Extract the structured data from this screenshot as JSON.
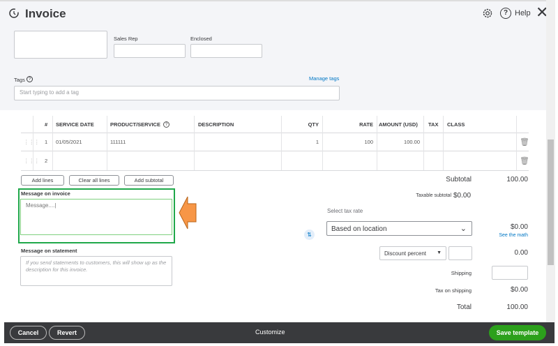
{
  "header": {
    "title": "Invoice",
    "help_label": "Help"
  },
  "form": {
    "sales_rep_label": "Sales Rep",
    "enclosed_label": "Enclosed",
    "tags_label": "Tags",
    "manage_tags": "Manage tags",
    "tags_placeholder": "Start typing to add a tag"
  },
  "table": {
    "columns": [
      "#",
      "SERVICE DATE",
      "PRODUCT/SERVICE",
      "DESCRIPTION",
      "QTY",
      "RATE",
      "AMOUNT (USD)",
      "TAX",
      "CLASS"
    ],
    "rows": [
      {
        "num": "1",
        "date": "01/05/2021",
        "product": "111111",
        "description": "",
        "qty": "1",
        "rate": "100",
        "amount": "100.00"
      },
      {
        "num": "2",
        "date": "",
        "product": "",
        "description": "",
        "qty": "",
        "rate": "",
        "amount": ""
      }
    ]
  },
  "actions": {
    "add_lines": "Add lines",
    "clear_lines": "Clear all lines",
    "add_subtotal": "Add subtotal"
  },
  "messages": {
    "invoice_label": "Message on invoice",
    "invoice_value": "Message....|",
    "statement_label": "Message on statement",
    "statement_placeholder": "If you send statements to customers, this will show up as the description for this invoice."
  },
  "totals": {
    "subtotal_label": "Subtotal",
    "subtotal": "100.00",
    "taxable_label": "Taxable subtotal",
    "taxable": "$0.00",
    "tax_rate_label": "Select tax rate",
    "tax_rate_value": "Based on location",
    "tax": "$0.00",
    "see_math": "See the math",
    "discount_type": "Discount percent",
    "discount": "0.00",
    "shipping_label": "Shipping",
    "tax_shipping_label": "Tax on shipping",
    "tax_shipping": "$0.00",
    "total_label": "Total",
    "total": "100.00"
  },
  "footer": {
    "cancel": "Cancel",
    "revert": "Revert",
    "customize": "Customize",
    "save": "Save template"
  },
  "colors": {
    "accent_green": "#2ca01c",
    "highlight_green": "#1fa84a",
    "arrow_orange": "#f79646",
    "footer_bg": "#393a3d"
  }
}
